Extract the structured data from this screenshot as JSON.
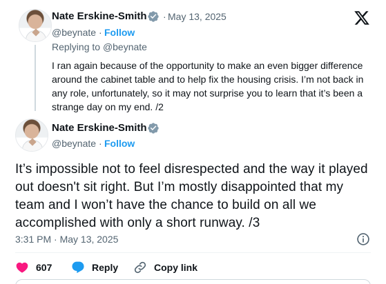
{
  "first_tweet": {
    "author_name": "Nate Erskine-Smith",
    "handle": "@beynate",
    "date": "May 13, 2025",
    "follow_label": "Follow",
    "replying_prefix": "Replying to",
    "replying_to": "@beynate",
    "text": "I ran again because of the opportunity to make an even bigger difference around the cabinet table and to help fix the housing crisis. I’m not back in any role, unfortunately, so it may not surprise you to learn that it’s been a strange day on my end. /2"
  },
  "main_tweet": {
    "author_name": "Nate Erskine-Smith",
    "handle": "@beynate",
    "follow_label": "Follow",
    "text": "It’s impossible not to feel disrespected and the way it played out doesn't sit right. But I’m mostly disappointed that my team and I won’t have the chance to build on all we accomplished with only a short runway. /3",
    "timestamp": "3:31 PM · May 13, 2025"
  },
  "actions": {
    "likes_count": "607",
    "reply_label": "Reply",
    "copy_link_label": "Copy link"
  },
  "icons": {
    "logo": "x-logo-icon",
    "verified": "verified-badge-icon",
    "info": "info-icon",
    "like": "heart-icon",
    "reply": "speech-bubble-icon",
    "copy": "link-icon"
  },
  "colors": {
    "accent": "#1d9bf0",
    "like": "#f91880",
    "muted": "#536471",
    "text": "#0f1419"
  }
}
